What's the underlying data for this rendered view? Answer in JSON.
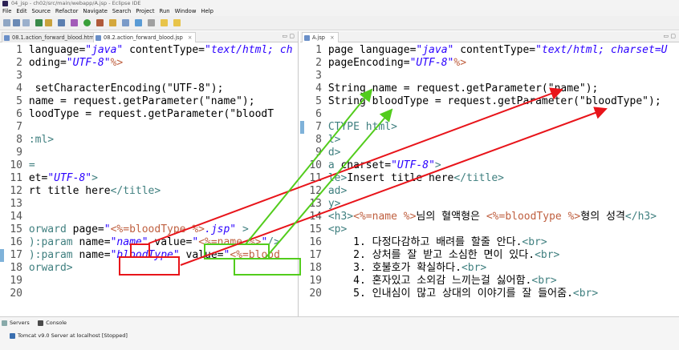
{
  "window": {
    "title": "04_jsp - ch02/src/main/webapp/A.jsp - Eclipse IDE"
  },
  "menu": [
    "File",
    "Edit",
    "Source",
    "Refactor",
    "Navigate",
    "Search",
    "Project",
    "Run",
    "Window",
    "Help"
  ],
  "left_editor": {
    "tabs": [
      {
        "label": "08.1.action_forward_blood.html",
        "active": false
      },
      {
        "label": "08.2.action_forward_blood.jsp",
        "active": true
      }
    ],
    "lines": [
      {
        "n": "1",
        "parts": [
          [
            "kw",
            "language="
          ],
          [
            "str",
            "\"java\""
          ],
          [
            "kw",
            " contentType="
          ],
          [
            "str",
            "\"text/html; ch"
          ]
        ]
      },
      {
        "n": "2",
        "parts": [
          [
            "kw",
            "oding="
          ],
          [
            "str",
            "\"UTF-8\""
          ],
          [
            "mk",
            "%>"
          ]
        ]
      },
      {
        "n": "3",
        "parts": []
      },
      {
        "n": "4",
        "parts": [
          [
            "kw",
            " setCharacterEncoding(\"UTF-8\");"
          ]
        ]
      },
      {
        "n": "5",
        "parts": [
          [
            "kw",
            "name = request.getParameter(\"name\");"
          ]
        ]
      },
      {
        "n": "6",
        "parts": [
          [
            "kw",
            "loodType = request.getParameter(\"bloodT"
          ]
        ]
      },
      {
        "n": "7",
        "parts": []
      },
      {
        "n": "8",
        "parts": [
          [
            "tag",
            ":ml>"
          ]
        ]
      },
      {
        "n": "9",
        "parts": []
      },
      {
        "n": "10",
        "parts": [
          [
            "tag",
            "="
          ]
        ]
      },
      {
        "n": "11",
        "parts": [
          [
            "kw",
            "et="
          ],
          [
            "str",
            "\"UTF-8\""
          ],
          [
            "tag",
            ">"
          ]
        ]
      },
      {
        "n": "12",
        "parts": [
          [
            "kw",
            "rt title here"
          ],
          [
            "tag",
            "</title>"
          ]
        ]
      },
      {
        "n": "13",
        "parts": []
      },
      {
        "n": "14",
        "parts": []
      },
      {
        "n": "15",
        "parts": [
          [
            "tag",
            "orward"
          ],
          [
            "kw",
            " page="
          ],
          [
            "str",
            "\""
          ],
          [
            "mk",
            "<%=bloodType %>"
          ],
          [
            "str",
            ".jsp\""
          ],
          [
            "tag",
            " >"
          ]
        ]
      },
      {
        "n": "16",
        "parts": [
          [
            "tag",
            "):param"
          ],
          [
            "kw",
            " name="
          ],
          [
            "str",
            "\"name\""
          ],
          [
            "kw",
            " value="
          ],
          [
            "str",
            "\""
          ],
          [
            "mk",
            "<%=name %>"
          ],
          [
            "str",
            "\""
          ],
          [
            "tag",
            "/>"
          ]
        ]
      },
      {
        "n": "17",
        "parts": [
          [
            "tag",
            "):param"
          ],
          [
            "kw",
            " name="
          ],
          [
            "str",
            "\"bloodType\""
          ],
          [
            "kw",
            " value="
          ],
          [
            "str",
            "\""
          ],
          [
            "mk",
            "<%=blood"
          ]
        ]
      },
      {
        "n": "18",
        "parts": [
          [
            "tag",
            "orward>"
          ]
        ]
      },
      {
        "n": "19",
        "parts": []
      },
      {
        "n": "20",
        "parts": []
      }
    ]
  },
  "right_editor": {
    "tabs": [
      {
        "label": "A.jsp",
        "active": true
      }
    ],
    "lines": [
      {
        "n": "1",
        "parts": [
          [
            "kw",
            "page language="
          ],
          [
            "str",
            "\"java\""
          ],
          [
            "kw",
            " contentType="
          ],
          [
            "str",
            "\"text/html; charset=U"
          ]
        ]
      },
      {
        "n": "2",
        "parts": [
          [
            "kw",
            "pageEncoding="
          ],
          [
            "str",
            "\"UTF-8\""
          ],
          [
            "mk",
            "%>"
          ]
        ]
      },
      {
        "n": "3",
        "parts": []
      },
      {
        "n": "4",
        "parts": [
          [
            "kw",
            "String name = request.getParameter(\"name\");"
          ]
        ]
      },
      {
        "n": "5",
        "parts": [
          [
            "kw",
            "String bloodType = request.getParameter(\"bloodType\");"
          ]
        ]
      },
      {
        "n": "6",
        "parts": []
      },
      {
        "n": "7",
        "parts": [
          [
            "tag",
            "CTYPE html>"
          ]
        ]
      },
      {
        "n": "8",
        "parts": [
          [
            "tag",
            "l>"
          ]
        ]
      },
      {
        "n": "9",
        "parts": [
          [
            "tag",
            "d>"
          ]
        ]
      },
      {
        "n": "10",
        "parts": [
          [
            "tag",
            "a"
          ],
          [
            "kw",
            " charset="
          ],
          [
            "str",
            "\"UTF-8\""
          ],
          [
            "tag",
            ">"
          ]
        ]
      },
      {
        "n": "11",
        "parts": [
          [
            "tag",
            "le>"
          ],
          [
            "kw",
            "Insert title here"
          ],
          [
            "tag",
            "</title>"
          ]
        ]
      },
      {
        "n": "12",
        "parts": [
          [
            "tag",
            "ad>"
          ]
        ]
      },
      {
        "n": "13",
        "parts": [
          [
            "tag",
            "y>"
          ]
        ]
      },
      {
        "n": "14",
        "parts": [
          [
            "tag",
            "<h3>"
          ],
          [
            "mk",
            "<%=name %>"
          ],
          [
            "kw",
            "님의 혈액형은 "
          ],
          [
            "mk",
            "<%=bloodType %>"
          ],
          [
            "kw",
            "형의 성격"
          ],
          [
            "tag",
            "</h3>"
          ]
        ]
      },
      {
        "n": "15",
        "parts": [
          [
            "tag",
            "<p>"
          ]
        ]
      },
      {
        "n": "16",
        "parts": [
          [
            "kw",
            "    1. 다정다감하고 배려를 할줄 안다."
          ],
          [
            "tag",
            "<br>"
          ]
        ]
      },
      {
        "n": "17",
        "parts": [
          [
            "kw",
            "    2. 상처를 잘 받고 소심한 면이 있다."
          ],
          [
            "tag",
            "<br>"
          ]
        ]
      },
      {
        "n": "18",
        "parts": [
          [
            "kw",
            "    3. 호불호가 확실하다."
          ],
          [
            "tag",
            "<br>"
          ]
        ]
      },
      {
        "n": "19",
        "parts": [
          [
            "kw",
            "    4. 혼자있고 소외감 느끼는걸 싫어함."
          ],
          [
            "tag",
            "<br>"
          ]
        ]
      },
      {
        "n": "20",
        "parts": [
          [
            "kw",
            "    5. 인내심이 많고 상대의 이야기를 잘 들어줌."
          ],
          [
            "tag",
            "<br>"
          ]
        ]
      }
    ]
  },
  "bottom": {
    "tabs": [
      "Servers",
      "Console"
    ],
    "server_item": "Tomcat v9.0 Server at localhost  [Stopped]"
  },
  "colors": {
    "arrow_red": "#e8141a",
    "arrow_green": "#52cc1c"
  }
}
